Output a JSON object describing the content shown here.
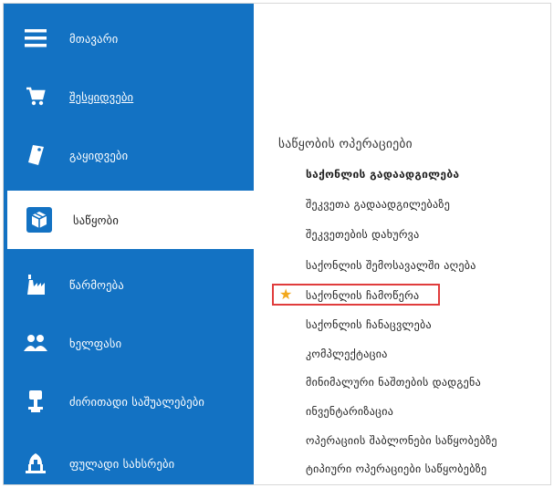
{
  "sidebar": {
    "items": [
      {
        "label": "მთავარი",
        "icon": "menu-icon"
      },
      {
        "label": "შესყიდვები",
        "icon": "cart-icon"
      },
      {
        "label": "გაყიდვები",
        "icon": "tag-icon"
      },
      {
        "label": "საწყობი",
        "icon": "box-icon"
      },
      {
        "label": "წარმოება",
        "icon": "factory-icon"
      },
      {
        "label": "ხელფასი",
        "icon": "people-icon"
      },
      {
        "label": "ძირითადი საშუალებები",
        "icon": "podium-icon"
      },
      {
        "label": "ფულადი სახსრები",
        "icon": "bank-icon"
      }
    ],
    "active_index": 3,
    "colors": {
      "background": "#1372c3",
      "active_background": "#ffffff"
    }
  },
  "content": {
    "section_title": "საწყობის ოპერაციები",
    "links": [
      "საქონლის გადაადგილება",
      "შეკვეთა გადაადგილებაზე",
      "შეკვეთების დახურვა",
      "საქონლის შემოსავალში აღება",
      "საქონლის ჩამოწერა",
      "საქონლის ჩანაცვლება",
      "კომპლექტაცია",
      "მინიმალური ნაშთების დადგენა",
      "ინვენტარიზაცია",
      "ოპერაციის შაბლონები საწყობებზე",
      "ტიპიური ოპერაციები საწყობებზე"
    ],
    "bold_index": 0,
    "highlighted_index": 4,
    "colors": {
      "highlight_border": "#e03c3c",
      "star": "#f2a81d"
    }
  }
}
